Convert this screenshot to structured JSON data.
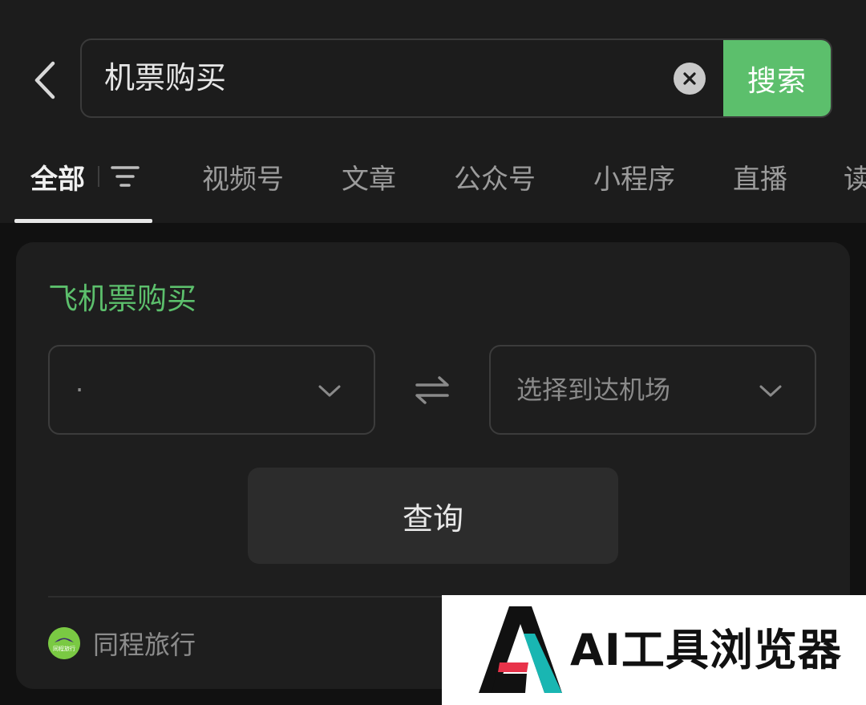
{
  "search": {
    "query": "机票购买",
    "button_label": "搜索"
  },
  "tabs": [
    {
      "label": "全部",
      "active": true
    },
    {
      "label": "视频号"
    },
    {
      "label": "文章"
    },
    {
      "label": "公众号"
    },
    {
      "label": "小程序"
    },
    {
      "label": "直播"
    },
    {
      "label": "读"
    }
  ],
  "card": {
    "title": "飞机票购买",
    "departure": {
      "value": "·"
    },
    "arrival": {
      "placeholder": "选择到达机场"
    },
    "query_button_label": "查询",
    "provider": {
      "name": "同程旅行",
      "logo_text": "同程旅行"
    }
  },
  "watermark": {
    "logo_letter": "A",
    "text": "AI工具浏览器"
  },
  "colors": {
    "background": "#111111",
    "header_bg": "#1c1c1c",
    "card_bg": "#1e1e1e",
    "accent_green": "#5cbf6c",
    "active_tab": "#f0f0f0",
    "inactive_tab": "#9b9b9b"
  },
  "icons": {
    "back": "chevron-left-icon",
    "clear": "clear-circle-icon",
    "filter": "filter-lines-icon",
    "dropdown": "chevron-down-icon",
    "swap": "swap-arrows-icon",
    "provider_logo": "tongcheng-logo-icon",
    "watermark_logo": "ai-logo-icon"
  }
}
